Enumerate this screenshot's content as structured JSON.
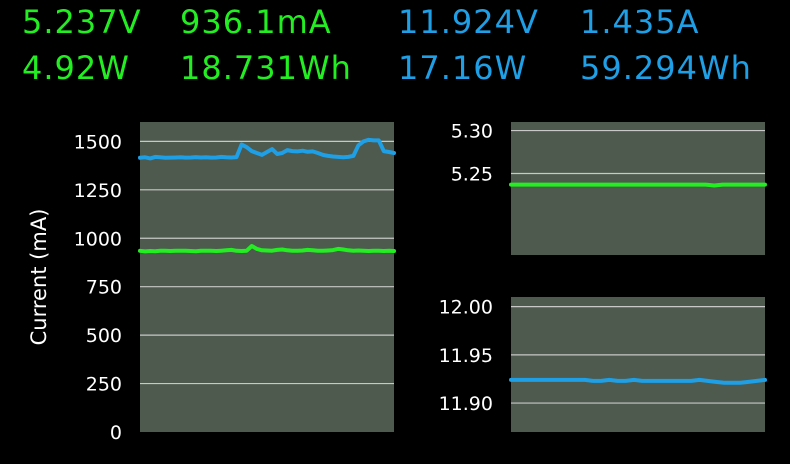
{
  "readouts": {
    "usb_voltage": "5.237V",
    "usb_current": "936.1mA",
    "usb_power": "4.92W",
    "usb_energy": "18.731Wh",
    "dc_voltage": "11.924V",
    "dc_current": "1.435A",
    "dc_power": "17.16W",
    "dc_energy": "59.294Wh"
  },
  "colors": {
    "usb": "#22ee22",
    "dc": "#1e9fe6",
    "plot_bg": "#4d5a4d",
    "grid": "#c8c8c8",
    "background": "#000000"
  },
  "chart_data": [
    {
      "type": "line",
      "ylabel": "Current (mA)",
      "ylim": [
        0,
        1600
      ],
      "yticks": [
        0,
        250,
        500,
        750,
        1000,
        1250,
        1500
      ],
      "grid": true,
      "series": [
        {
          "color": "#1e9fe6",
          "values": [
            1415,
            1418,
            1412,
            1420,
            1418,
            1415,
            1416,
            1417,
            1418,
            1416,
            1417,
            1419,
            1417,
            1418,
            1416,
            1417,
            1420,
            1418,
            1417,
            1419,
            1484,
            1470,
            1450,
            1440,
            1430,
            1445,
            1460,
            1435,
            1440,
            1455,
            1450,
            1448,
            1452,
            1446,
            1448,
            1440,
            1430,
            1425,
            1422,
            1420,
            1418,
            1420,
            1425,
            1480,
            1500,
            1508,
            1505,
            1505,
            1450,
            1445,
            1440
          ]
        },
        {
          "color": "#22ee22",
          "values": [
            935,
            932,
            934,
            933,
            936,
            935,
            934,
            935,
            936,
            935,
            934,
            933,
            935,
            936,
            935,
            934,
            936,
            938,
            940,
            935,
            934,
            936,
            960,
            945,
            938,
            937,
            936,
            940,
            942,
            938,
            936,
            935,
            937,
            940,
            938,
            936,
            935,
            937,
            939,
            945,
            942,
            938,
            936,
            937,
            935,
            934,
            936,
            935,
            934,
            935,
            934
          ]
        }
      ]
    },
    {
      "type": "line",
      "ylim": [
        5.155,
        5.31
      ],
      "yticks": [
        5.25,
        5.3
      ],
      "grid": true,
      "series": [
        {
          "color": "#22ee22",
          "values": [
            5.237,
            5.237,
            5.237,
            5.237,
            5.237,
            5.237,
            5.237,
            5.237,
            5.237,
            5.237,
            5.237,
            5.237,
            5.237,
            5.237,
            5.237,
            5.237,
            5.237,
            5.237,
            5.237,
            5.237,
            5.237,
            5.237,
            5.237,
            5.237,
            5.236,
            5.237,
            5.237,
            5.237,
            5.237,
            5.237,
            5.237
          ]
        }
      ]
    },
    {
      "type": "line",
      "ylim": [
        11.87,
        12.01
      ],
      "yticks": [
        11.9,
        11.95,
        12.0
      ],
      "grid": true,
      "series": [
        {
          "color": "#1e9fe6",
          "values": [
            11.924,
            11.924,
            11.924,
            11.924,
            11.924,
            11.924,
            11.924,
            11.924,
            11.924,
            11.924,
            11.923,
            11.923,
            11.924,
            11.923,
            11.923,
            11.924,
            11.923,
            11.923,
            11.923,
            11.923,
            11.923,
            11.923,
            11.923,
            11.924,
            11.923,
            11.922,
            11.921,
            11.921,
            11.921,
            11.922,
            11.923,
            11.924
          ]
        }
      ]
    }
  ]
}
